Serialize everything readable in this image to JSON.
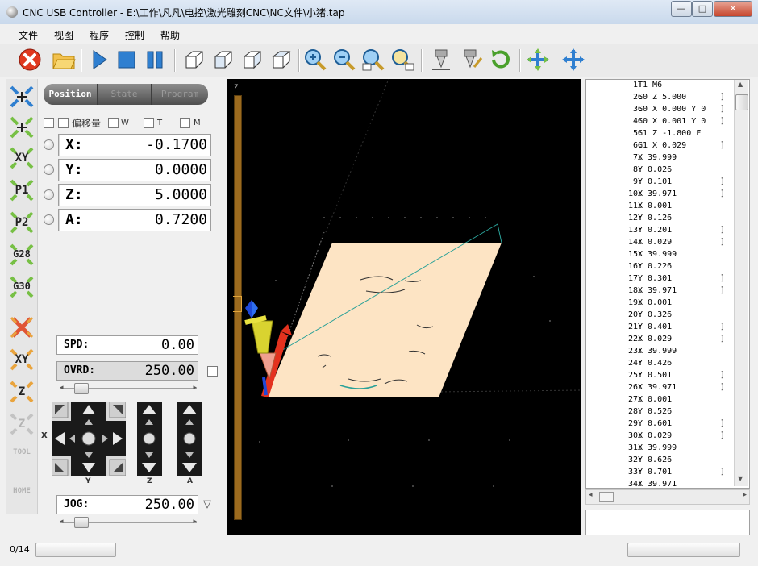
{
  "window": {
    "title": "CNC USB Controller - E:\\工作\\凡凡\\电控\\激光雕刻CNC\\NC文件\\小猪.tap",
    "btn_min": "—",
    "btn_max": "□",
    "btn_close": "✕"
  },
  "menu": [
    "文件",
    "视图",
    "程序",
    "控制",
    "帮助"
  ],
  "toolbar": {
    "icons": [
      "stop-icon",
      "open-folder-icon",
      "play-icon",
      "stop-square-icon",
      "pause-icon",
      "view-iso-icon",
      "view-front-icon",
      "view-side-icon",
      "view-top-icon",
      "zoom-in-icon",
      "zoom-out-icon",
      "zoom-fit-icon",
      "zoom-window-icon",
      "tool-touch-icon",
      "tool-edit-icon",
      "repeat-icon",
      "home-all-icon",
      "home-xyz-icon"
    ]
  },
  "left_strip": {
    "labels": [
      "",
      "",
      "XY",
      "P1",
      "P2",
      "G28",
      "G30",
      "",
      "XY",
      "Z",
      "Z",
      "TOOL",
      "HOME"
    ]
  },
  "tabs": [
    "Position",
    "State",
    "Program"
  ],
  "flags": {
    "offset": "偏移量",
    "w": "W",
    "t": "T",
    "m": "M"
  },
  "dro": [
    {
      "axis": "X:",
      "value": "-0.1700"
    },
    {
      "axis": "Y:",
      "value": "0.0000"
    },
    {
      "axis": "Z:",
      "value": "5.0000"
    },
    {
      "axis": "A:",
      "value": "0.7200"
    }
  ],
  "spd": {
    "label": "SPD:",
    "value": "0.00"
  },
  "ovrd": {
    "label": "OVRD:",
    "value": "250.00"
  },
  "jog": {
    "label": "JOG:",
    "value": "250.00"
  },
  "jog_labels": {
    "x": "X",
    "y": "Y",
    "z": "Z",
    "a": "A"
  },
  "viewport": {
    "axis_label": "Z"
  },
  "gcode": [
    {
      "n": "1:",
      "code": "T1 M6",
      "b": ""
    },
    {
      "n": "2:",
      "code": "G0 Z 5.000",
      "b": "]"
    },
    {
      "n": "3:",
      "code": "G0 X 0.000 Y 0",
      "b": "]"
    },
    {
      "n": "4:",
      "code": "G0 X 0.001 Y 0",
      "b": "]"
    },
    {
      "n": "5:",
      "code": "G1 Z -1.800 F",
      "b": ""
    },
    {
      "n": "6:",
      "code": "G1 X 0.029",
      "b": "]"
    },
    {
      "n": "7:",
      "code": "X 39.999",
      "b": ""
    },
    {
      "n": "8:",
      "code": "Y 0.026",
      "b": ""
    },
    {
      "n": "9:",
      "code": "Y 0.101",
      "b": "]"
    },
    {
      "n": "10:",
      "code": "X 39.971",
      "b": "]"
    },
    {
      "n": "11:",
      "code": "X 0.001",
      "b": ""
    },
    {
      "n": "12:",
      "code": "Y 0.126",
      "b": ""
    },
    {
      "n": "13:",
      "code": "Y 0.201",
      "b": "]"
    },
    {
      "n": "14:",
      "code": "X 0.029",
      "b": "]"
    },
    {
      "n": "15:",
      "code": "X 39.999",
      "b": ""
    },
    {
      "n": "16:",
      "code": "Y 0.226",
      "b": ""
    },
    {
      "n": "17:",
      "code": "Y 0.301",
      "b": "]"
    },
    {
      "n": "18:",
      "code": "X 39.971",
      "b": "]"
    },
    {
      "n": "19:",
      "code": "X 0.001",
      "b": ""
    },
    {
      "n": "20:",
      "code": "Y 0.326",
      "b": ""
    },
    {
      "n": "21:",
      "code": "Y 0.401",
      "b": "]"
    },
    {
      "n": "22:",
      "code": "X 0.029",
      "b": "]"
    },
    {
      "n": "23:",
      "code": "X 39.999",
      "b": ""
    },
    {
      "n": "24:",
      "code": "Y 0.426",
      "b": ""
    },
    {
      "n": "25:",
      "code": "Y 0.501",
      "b": "]"
    },
    {
      "n": "26:",
      "code": "X 39.971",
      "b": "]"
    },
    {
      "n": "27:",
      "code": "X 0.001",
      "b": ""
    },
    {
      "n": "28:",
      "code": "Y 0.526",
      "b": ""
    },
    {
      "n": "29:",
      "code": "Y 0.601",
      "b": "]"
    },
    {
      "n": "30:",
      "code": "X 0.029",
      "b": "]"
    },
    {
      "n": "31:",
      "code": "X 39.999",
      "b": ""
    },
    {
      "n": "32:",
      "code": "Y 0.626",
      "b": ""
    },
    {
      "n": "33:",
      "code": "Y 0.701",
      "b": "]"
    },
    {
      "n": "34:",
      "code": "X 39.971",
      "b": ""
    }
  ],
  "status": {
    "counter": "0/14"
  },
  "colors": {
    "stop_red": "#e0381f",
    "play_blue": "#2f7fd0",
    "workpiece": "#fde4c4",
    "z_scale": "#9b6a1e",
    "toolpath": "#2aa198"
  }
}
